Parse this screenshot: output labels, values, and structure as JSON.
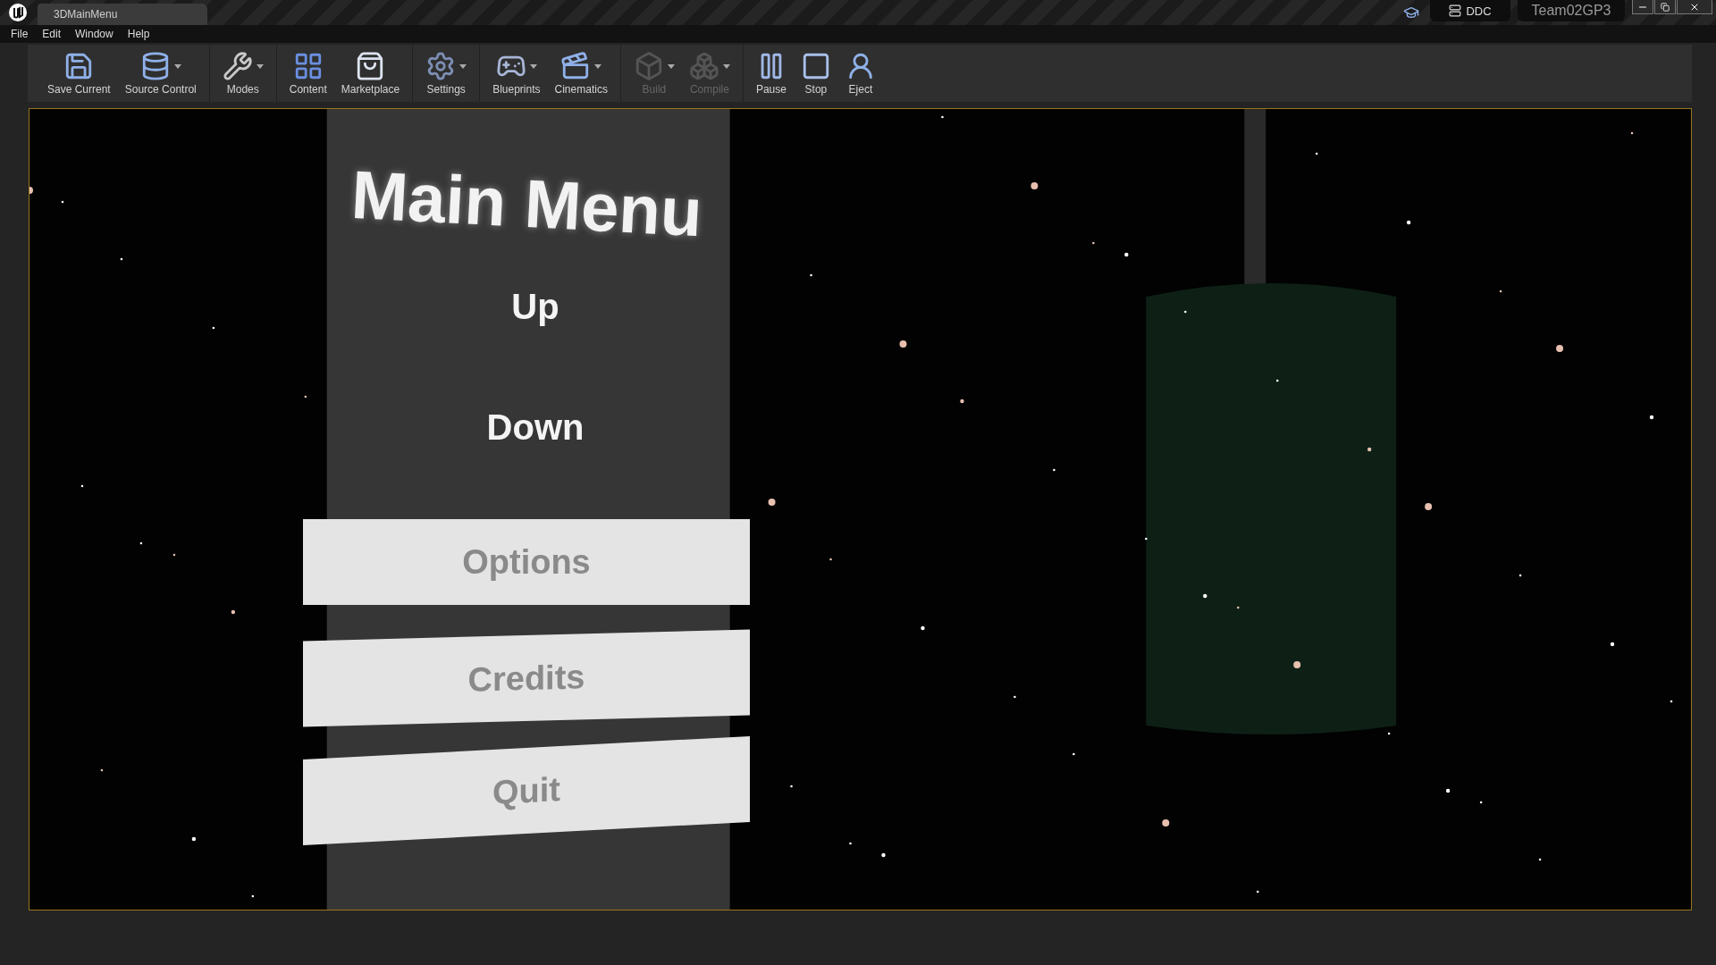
{
  "window": {
    "tab": "3DMainMenu",
    "ddc": "DDC",
    "project": "Team02GP3"
  },
  "menu": [
    "File",
    "Edit",
    "Window",
    "Help"
  ],
  "toolbar": [
    [
      {
        "label": "Save Current",
        "kind": "save",
        "dropdown": false,
        "disabled": false
      },
      {
        "label": "Source Control",
        "kind": "source",
        "dropdown": true,
        "disabled": false
      }
    ],
    [
      {
        "label": "Modes",
        "kind": "modes",
        "dropdown": true,
        "disabled": false
      }
    ],
    [
      {
        "label": "Content",
        "kind": "content",
        "dropdown": false,
        "disabled": false
      },
      {
        "label": "Marketplace",
        "kind": "market",
        "dropdown": false,
        "disabled": false
      }
    ],
    [
      {
        "label": "Settings",
        "kind": "settings",
        "dropdown": true,
        "disabled": false
      }
    ],
    [
      {
        "label": "Blueprints",
        "kind": "blueprints",
        "dropdown": true,
        "disabled": false
      },
      {
        "label": "Cinematics",
        "kind": "cinematics",
        "dropdown": true,
        "disabled": false
      }
    ],
    [
      {
        "label": "Build",
        "kind": "build",
        "dropdown": true,
        "disabled": true
      },
      {
        "label": "Compile",
        "kind": "compile",
        "dropdown": true,
        "disabled": true
      }
    ],
    [
      {
        "label": "Pause",
        "kind": "pause",
        "dropdown": false,
        "disabled": false
      },
      {
        "label": "Stop",
        "kind": "stop",
        "dropdown": false,
        "disabled": false
      },
      {
        "label": "Eject",
        "kind": "eject",
        "dropdown": false,
        "disabled": false
      }
    ]
  ],
  "viewport": {
    "kind": "picture",
    "title": "Main Menu",
    "options": [
      "Up",
      "Down"
    ],
    "buttons": [
      "Options",
      "Credits",
      "Quit"
    ]
  }
}
